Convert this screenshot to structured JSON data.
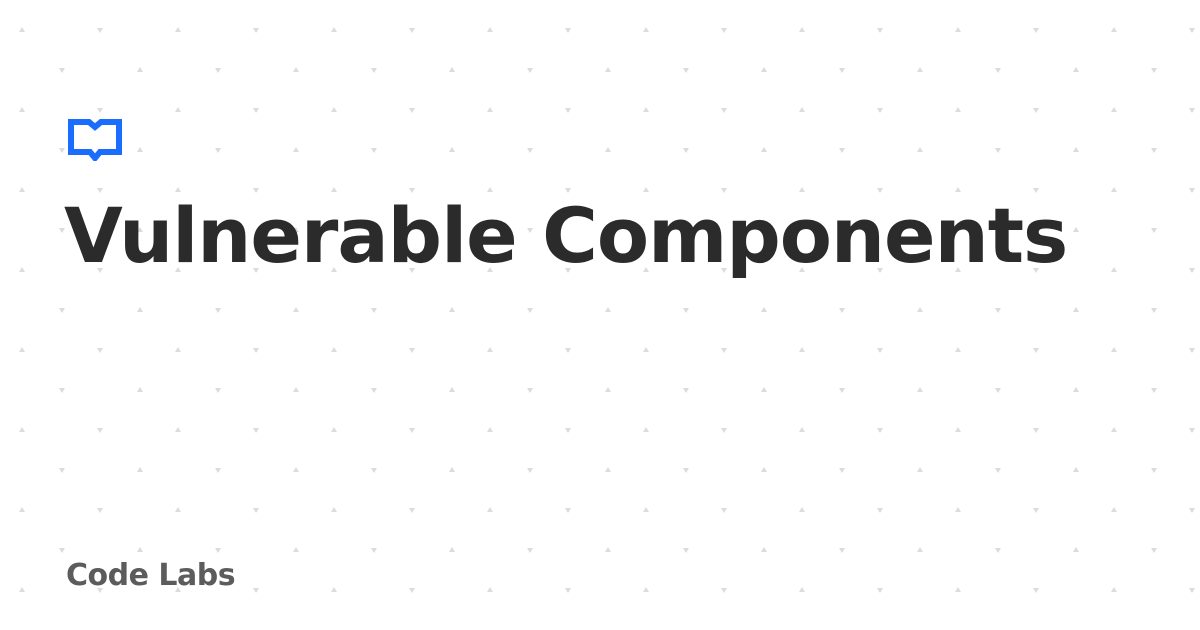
{
  "card": {
    "title": "Vulnerable Components",
    "brand": "Code Labs",
    "logo_icon": "book-comment-icon"
  },
  "colors": {
    "background": "#ffffff",
    "pattern": "#dcdcdc",
    "accent": "#1a6dff",
    "title": "#2b2b2b",
    "brand": "#5c5c5c"
  }
}
